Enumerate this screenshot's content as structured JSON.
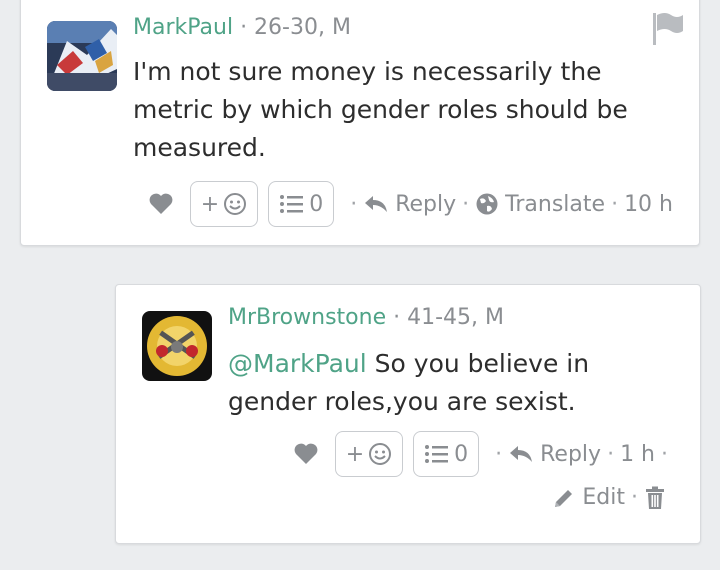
{
  "comments": [
    {
      "username": "MarkPaul",
      "meta_suffix": " · 26-30, M",
      "text": "I'm not sure money is necessarily the metric by which gender roles should be measured.",
      "react_label": "+",
      "list_count": "0",
      "reply_label": "Reply",
      "translate_label": "Translate",
      "time": "10 h"
    },
    {
      "username": "MrBrownstone",
      "meta_suffix": " · 41-45, M",
      "mention": "@MarkPaul",
      "text": " So you believe in gender roles,you are sexist.",
      "react_label": "+",
      "list_count": "0",
      "reply_label": "Reply",
      "time": "1 h",
      "edit_label": "Edit"
    }
  ],
  "colors": {
    "accent": "#4fa387",
    "muted": "#8a8d91",
    "background": "#ebedef"
  }
}
